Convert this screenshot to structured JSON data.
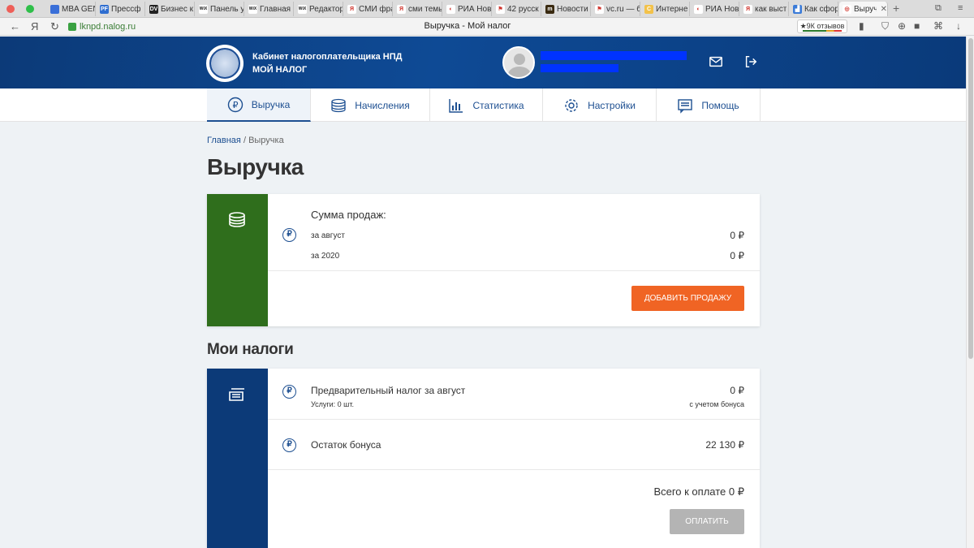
{
  "browser": {
    "tabs": [
      {
        "label": "MBA GEN",
        "fav": "flower-icon",
        "color": "#3a6fd8"
      },
      {
        "label": "Прессф",
        "fav": "pf-icon",
        "color": "#2f6ed0",
        "glyph": "PF"
      },
      {
        "label": "Бизнес к",
        "fav": "dv-icon",
        "color": "#222222",
        "glyph": "DV"
      },
      {
        "label": "Панель у",
        "fav": "wix-icon",
        "color": "#ffffff",
        "glyph": "WiX"
      },
      {
        "label": "Главная",
        "fav": "wix-icon",
        "color": "#ffffff",
        "glyph": "WiX"
      },
      {
        "label": "Редактор",
        "fav": "wix-icon",
        "color": "#ffffff",
        "glyph": "WiX"
      },
      {
        "label": "СМИ фра",
        "fav": "yandex-icon",
        "color": "#ffffff",
        "glyph": "Я"
      },
      {
        "label": "сми темы",
        "fav": "yandex-icon",
        "color": "#ffffff",
        "glyph": "Я"
      },
      {
        "label": "РИА Нов",
        "fav": "ria-icon",
        "color": "#ffffff",
        "glyph": "◐"
      },
      {
        "label": "42 русск",
        "fav": "flag-icon",
        "color": "#ffffff",
        "glyph": "⚑"
      },
      {
        "label": "Новости",
        "fav": "news-icon",
        "color": "#3a2a10",
        "glyph": "m"
      },
      {
        "label": "vc.ru — б",
        "fav": "vc-icon",
        "color": "#ffffff",
        "glyph": "⚑"
      },
      {
        "label": "Интерне",
        "fav": "c-icon",
        "color": "#f3c24a",
        "glyph": "C"
      },
      {
        "label": "РИА Нов",
        "fav": "ria-icon",
        "color": "#ffffff",
        "glyph": "◐"
      },
      {
        "label": "как выст",
        "fav": "yandex-icon",
        "color": "#ffffff",
        "glyph": "Я"
      },
      {
        "label": "Как сфор",
        "fav": "chart-icon",
        "color": "#3b7bd8",
        "glyph": "▟"
      },
      {
        "label": "Выруч",
        "fav": "nalog-icon",
        "color": "#ffffff",
        "glyph": "◎",
        "active": true
      }
    ],
    "close_glyph": "✕",
    "new_tab_glyph": "+",
    "domain": "lknpd.nalog.ru",
    "page_title": "Выручка - Мой налог",
    "reviews": "★9К отзывов",
    "back_glyph": "←",
    "yandex_glyph": "Я",
    "reload_glyph": "↻"
  },
  "header": {
    "brand_line1": "Кабинет налогоплательщика НПД",
    "brand_line2": "МОЙ НАЛОГ"
  },
  "nav": {
    "tabs": [
      {
        "label": "Выручка",
        "icon": "ruble-icon"
      },
      {
        "label": "Начисления",
        "icon": "coins-icon"
      },
      {
        "label": "Статистика",
        "icon": "chart-icon"
      },
      {
        "label": "Настройки",
        "icon": "gear-icon"
      },
      {
        "label": "Помощь",
        "icon": "help-icon"
      }
    ]
  },
  "breadcrumb": {
    "home": "Главная",
    "separator": "/",
    "current": "Выручка"
  },
  "page_title": "Выручка",
  "sales": {
    "heading": "Сумма продаж:",
    "rows": [
      {
        "label": "за август",
        "value": "0 ₽"
      },
      {
        "label": "за 2020",
        "value": "0 ₽"
      }
    ],
    "add_button": "ДОБАВИТЬ ПРОДАЖУ",
    "side_color": "#2f6e1c",
    "ruble_glyph": "₽"
  },
  "taxes": {
    "heading": "Мои налоги",
    "preliminary_label": "Предварительный налог за август",
    "preliminary_value": "0 ₽",
    "services": "Услуги: 0 шт.",
    "bonus_note": "с учетом бонуса",
    "bonus_label": "Остаток бонуса",
    "bonus_value": "22 130 ₽",
    "total": "Всего к оплате 0 ₽",
    "pay_button": "ОПЛАТИТЬ",
    "side_color": "#0c3a78"
  }
}
